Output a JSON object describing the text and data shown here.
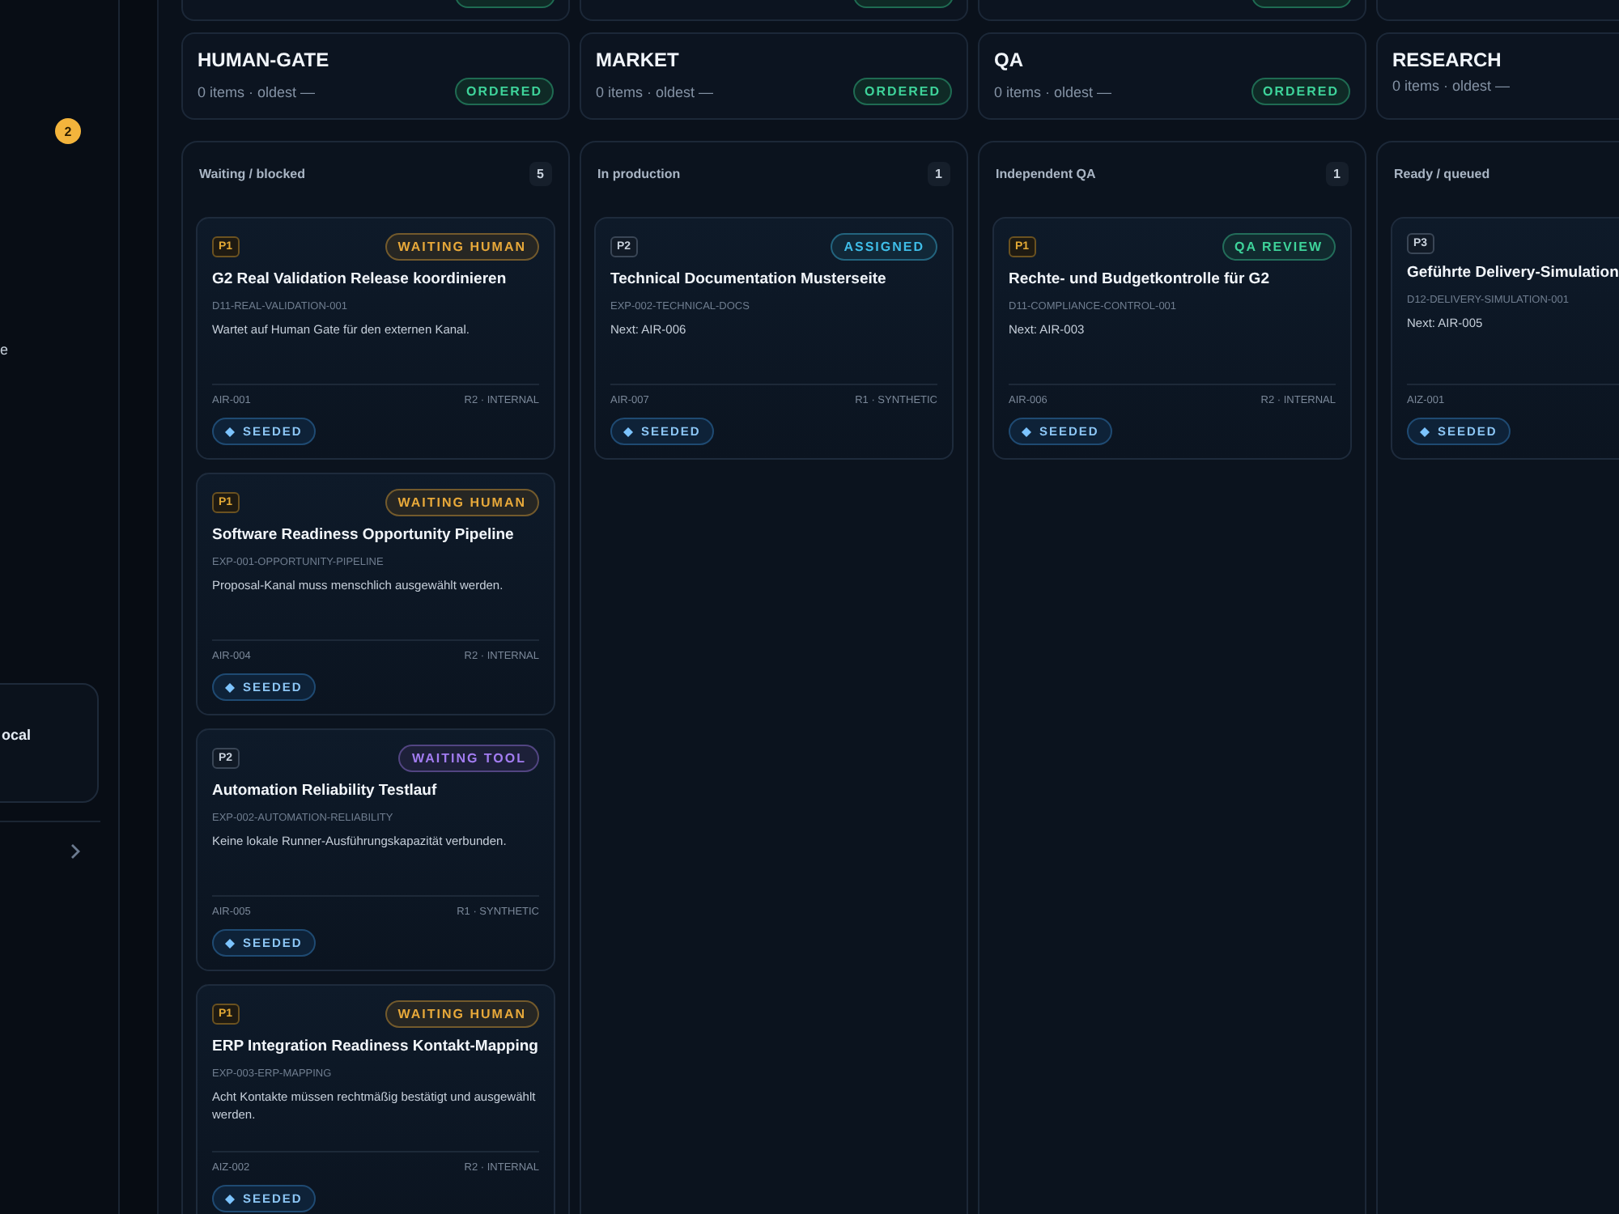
{
  "sidebar": {
    "badge": "2",
    "item_text": "e",
    "card_text": "ocal"
  },
  "top_groups": [
    {
      "kind": "ordered"
    },
    {
      "kind": "ordered"
    },
    {
      "kind": "ordered"
    },
    {
      "kind": "none"
    }
  ],
  "groups": [
    {
      "title": "HUMAN-GATE",
      "subtitle": "0 items · oldest —",
      "badge": "ORDERED"
    },
    {
      "title": "MARKET",
      "subtitle": "0 items · oldest —",
      "badge": "ORDERED"
    },
    {
      "title": "QA",
      "subtitle": "0 items · oldest —",
      "badge": "ORDERED"
    },
    {
      "title": "RESEARCH",
      "subtitle": "0 items · oldest —"
    }
  ],
  "lanes": [
    {
      "title": "Waiting / blocked",
      "count": "5",
      "cards": [
        {
          "priority": "P1",
          "urgent": true,
          "status": {
            "label": "WAITING HUMAN",
            "color": "#e8a93a"
          },
          "title": "G2 Real Validation Release koordinieren",
          "code": "D11-REAL-VALIDATION-001",
          "note": "Wartet auf Human Gate für den externen Kanal.",
          "id": "AIR-001",
          "risk": "R2 · INTERNAL",
          "tag": "SEEDED"
        },
        {
          "priority": "P1",
          "urgent": true,
          "status": {
            "label": "WAITING HUMAN",
            "color": "#e8a93a"
          },
          "title": "Software Readiness Opportunity Pipeline",
          "code": "EXP-001-OPPORTUNITY-PIPELINE",
          "note": "Proposal-Kanal muss menschlich ausgewählt werden.",
          "id": "AIR-004",
          "risk": "R2 · INTERNAL",
          "tag": "SEEDED"
        },
        {
          "priority": "P2",
          "urgent": false,
          "status": {
            "label": "WAITING TOOL",
            "color": "#a27cf0"
          },
          "title": "Automation Reliability Testlauf",
          "code": "EXP-002-AUTOMATION-RELIABILITY",
          "note": "Keine lokale Runner-Ausführungskapazität verbunden.",
          "id": "AIR-005",
          "risk": "R1 · SYNTHETIC",
          "tag": "SEEDED"
        },
        {
          "priority": "P1",
          "urgent": true,
          "status": {
            "label": "WAITING HUMAN",
            "color": "#e8a93a"
          },
          "title": "ERP Integration Readiness Kontakt-Mapping",
          "code": "EXP-003-ERP-MAPPING",
          "note": "Acht Kontakte müssen rechtmäßig bestätigt und ausgewählt werden.",
          "id": "AIZ-002",
          "risk": "R2 · INTERNAL",
          "tag": "SEEDED"
        }
      ]
    },
    {
      "title": "In production",
      "count": "1",
      "cards": [
        {
          "priority": "P2",
          "urgent": false,
          "status": {
            "label": "ASSIGNED",
            "color": "#3fbde8"
          },
          "title": "Technical Documentation Musterseite",
          "code": "EXP-002-TECHNICAL-DOCS",
          "note": "Next: AIR-006",
          "id": "AIR-007",
          "risk": "R1 · SYNTHETIC",
          "tag": "SEEDED"
        }
      ]
    },
    {
      "title": "Independent QA",
      "count": "1",
      "cards": [
        {
          "priority": "P1",
          "urgent": true,
          "status": {
            "label": "QA REVIEW",
            "color": "#3ed39a"
          },
          "title": "Rechte- und Budgetkontrolle für G2",
          "code": "D11-COMPLIANCE-CONTROL-001",
          "note": "Next: AIR-003",
          "id": "AIR-006",
          "risk": "R2 · INTERNAL",
          "tag": "SEEDED"
        }
      ]
    },
    {
      "title": "Ready / queued",
      "cards": [
        {
          "priority": "P3",
          "urgent": false,
          "title": "Geführte Delivery-Simulation",
          "code": "D12-DELIVERY-SIMULATION-001",
          "note": "Next: AIR-005",
          "id": "AIZ-001",
          "tag": "SEEDED"
        }
      ]
    }
  ]
}
